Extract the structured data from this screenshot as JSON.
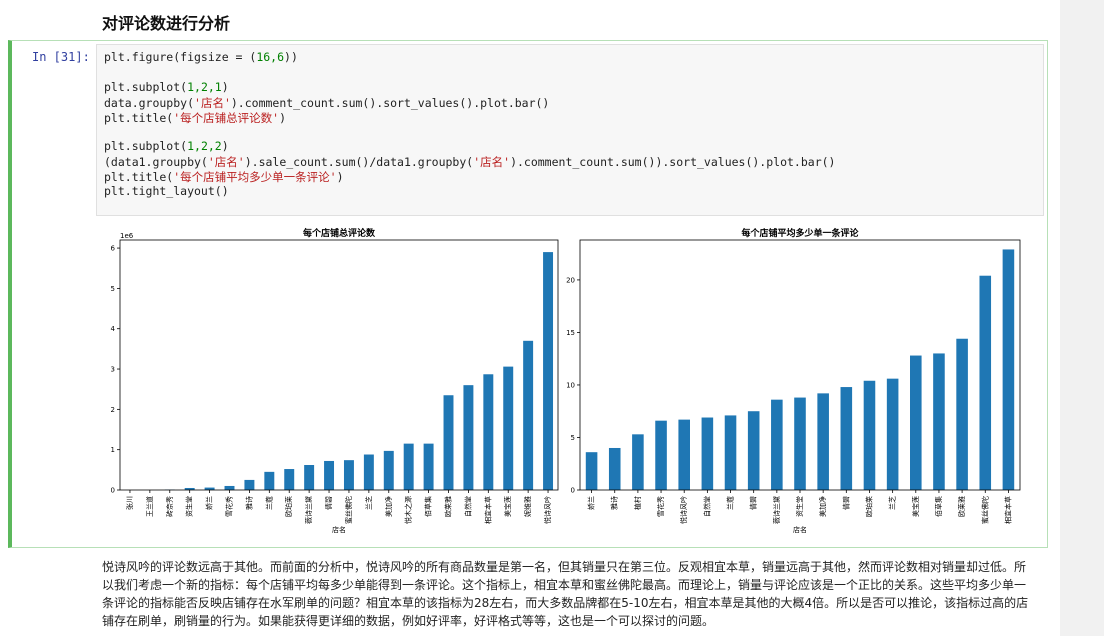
{
  "heading": "对评论数进行分析",
  "prompt": "In  [31]:",
  "code": {
    "l1a": "plt.figure(figsize = (",
    "l1n": "16,6",
    "l1b": "))",
    "l2a": "plt.subplot(",
    "l2n": "1,2,1",
    "l2b": ")",
    "l3a": "data.groupby(",
    "l3s": "'店名'",
    "l3b": ").comment_count.sum().sort_values().plot.bar()",
    "l4a": "plt.title(",
    "l4s": "'每个店铺总评论数'",
    "l4b": ")",
    "l5a": "plt.subplot(",
    "l5n": "1,2,2",
    "l5b": ")",
    "l6a": "(data1.groupby(",
    "l6s1": "'店名'",
    "l6b": ").sale_count.sum()/data1.groupby(",
    "l6s2": "'店名'",
    "l6c": ").comment_count.sum()).sort_values().plot.bar()",
    "l7a": "plt.title(",
    "l7s": "'每个店铺平均多少单一条评论'",
    "l7b": ")",
    "l8": "plt.tight_layout()"
  },
  "note": "悦诗风吟的评论数远高于其他。而前面的分析中，悦诗风吟的所有商品数量是第一名，但其销量只在第三位。反观相宜本草，销量远高于其他，然而评论数相对销量却过低。所以我们考虑一个新的指标：每个店铺平均每多少单能得到一条评论。这个指标上，相宜本草和蜜丝佛陀最高。而理论上，销量与评论应该是一个正比的关系。这些平均多少单一条评论的指标能否反映店铺存在水军刷单的问题？相宜本草的该指标为28左右，而大多数品牌都在5-10左右，相宜本草是其他的大概4倍。所以是否可以推论，该指标过高的店铺存在刷单，刷销量的行为。如果能获得更详细的数据，例如好评率，好评格式等等，这也是一个可以探讨的问题。",
  "chart_data": [
    {
      "type": "bar",
      "title": "每个店铺总评论数",
      "xlabel": "店名",
      "ylabel": "",
      "offset_label": "1e6",
      "ylim": [
        0,
        6.2
      ],
      "yticks": [
        "0",
        "1",
        "2",
        "3",
        "4",
        "5",
        "6"
      ],
      "color": "#1f77b4",
      "categories": [
        "张川",
        "王兰道",
        "砖奈秀",
        "资生堂",
        "娇兰",
        "雪花秀",
        "雅诗",
        "兰蔻",
        "欧珀莱",
        "薇诗兰黛",
        "倩碧",
        "蜜丝佛陀",
        "兰芝",
        "美加净",
        "悦木之源",
        "佰草集",
        "欧莱雅",
        "自然堂",
        "相宜本草",
        "美宝莲",
        "妮维雅",
        "悦诗风吟"
      ],
      "values": [
        0.0,
        0.0,
        0.01,
        0.05,
        0.06,
        0.1,
        0.25,
        0.45,
        0.52,
        0.62,
        0.72,
        0.74,
        0.88,
        0.97,
        1.15,
        1.15,
        2.35,
        2.6,
        2.87,
        3.06,
        3.7,
        5.9
      ]
    },
    {
      "type": "bar",
      "title": "每个店铺平均多少单一条评论",
      "xlabel": "店名",
      "ylabel": "",
      "ylim": [
        0,
        23.8
      ],
      "yticks": [
        "0",
        "5",
        "10",
        "15",
        "20"
      ],
      "color": "#1f77b4",
      "categories": [
        "娇兰",
        "雅诗",
        "植村",
        "雪花秀",
        "悦诗风吟",
        "自然堂",
        "兰蔻",
        "倩碧",
        "薇诗兰黛",
        "资生堂",
        "美加净",
        "倩碧",
        "欧珀莱",
        "兰芝",
        "美宝莲",
        "佰草集",
        "欧莱雅",
        "蜜丝佛陀",
        "相宜本草"
      ],
      "values": [
        3.6,
        4.0,
        5.3,
        6.6,
        6.7,
        6.9,
        7.1,
        7.5,
        8.6,
        8.8,
        9.2,
        9.8,
        10.4,
        10.6,
        12.8,
        13.0,
        14.4,
        20.4,
        22.9
      ]
    }
  ]
}
